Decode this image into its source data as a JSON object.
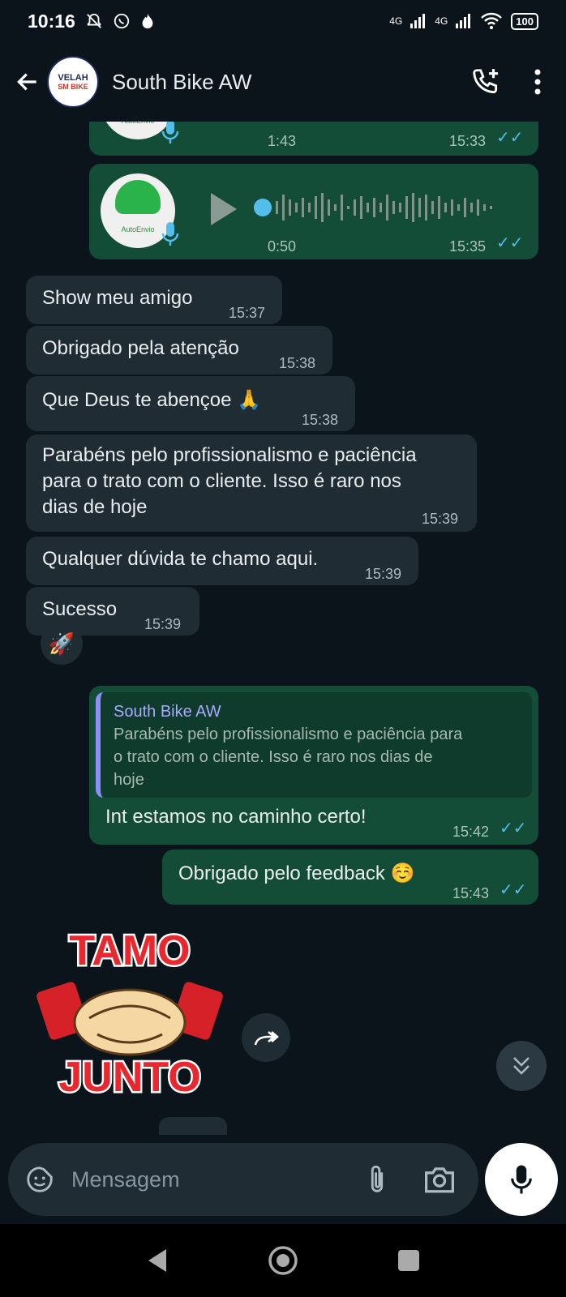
{
  "status": {
    "time": "10:16",
    "signal1": "4G",
    "signal2": "4G",
    "battery": "100"
  },
  "header": {
    "contact_name": "South Bike AW",
    "avatar_text1": "VELAH",
    "avatar_text2": "SM BIKE"
  },
  "voice_messages": [
    {
      "label": "AutoEnvio",
      "duration": "1:43",
      "time": "15:33"
    },
    {
      "label": "AutoEnvio",
      "duration": "0:50",
      "time": "15:35"
    }
  ],
  "incoming": [
    {
      "text": "Show meu amigo",
      "time": "15:37"
    },
    {
      "text": "Obrigado pela atenção",
      "time": "15:38"
    },
    {
      "text": "Que Deus te abençoe 🙏",
      "time": "15:38"
    },
    {
      "line1": "Parabéns pelo profissionalismo e paciência",
      "line2": "para o trato com o cliente. Isso é raro nos",
      "line3": "dias de hoje",
      "time": "15:39"
    },
    {
      "text": "Qualquer dúvida te chamo aqui.",
      "time": "15:39"
    },
    {
      "text": "Sucesso",
      "time": "15:39"
    }
  ],
  "reaction": "🚀",
  "reply": {
    "quoted_name": "South Bike AW",
    "quoted_line1": "Parabéns pelo profissionalismo e paciência para",
    "quoted_line2": "o trato com o cliente. Isso é raro nos dias de",
    "quoted_line3": "hoje",
    "text": "Int estamos no caminho certo!",
    "time": "15:42"
  },
  "outgoing_feedback": {
    "text": "Obrigado pelo feedback ☺️",
    "time": "15:43"
  },
  "sticker": {
    "top_text": "TAMO",
    "bottom_text": "JUNTO"
  },
  "composer": {
    "placeholder": "Mensagem"
  },
  "colors": {
    "bg": "#0b141a",
    "incoming": "#202c33",
    "outgoing": "#144d37",
    "ticks": "#53bdeb"
  }
}
